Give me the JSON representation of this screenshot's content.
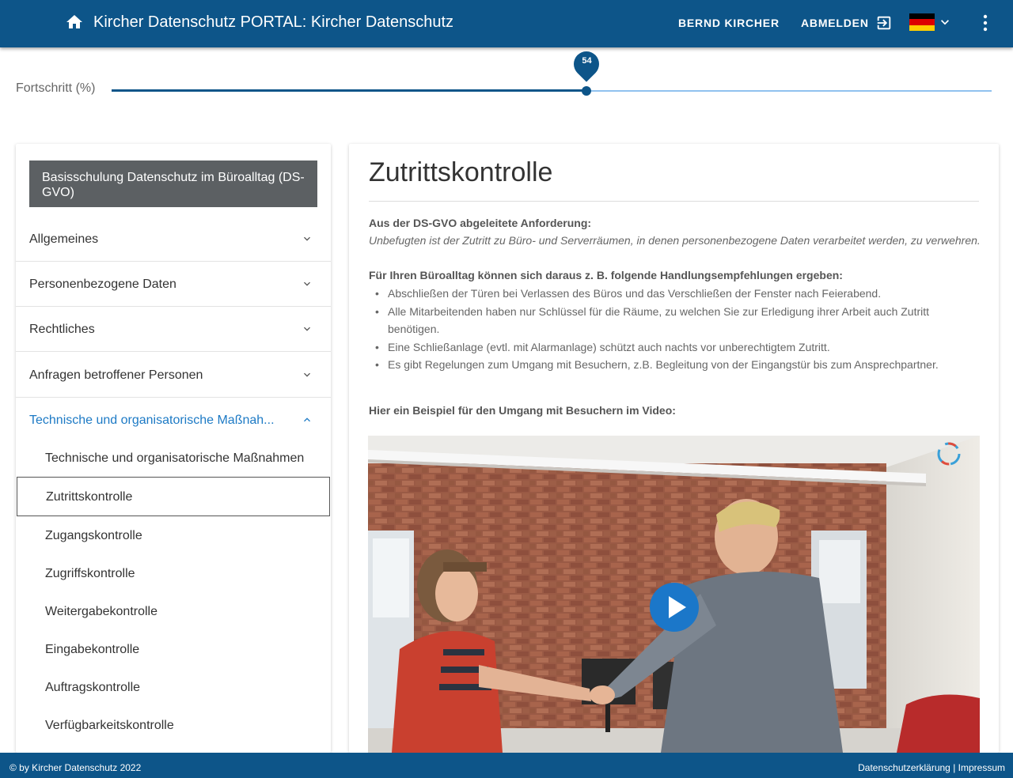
{
  "header": {
    "title": "Kircher Datenschutz PORTAL: Kircher Datenschutz",
    "user_label": "BERND KIRCHER",
    "logout_label": "ABMELDEN",
    "home_icon": "home-icon",
    "logout_icon": "logout-icon",
    "language_icon": "german-flag-icon",
    "menu_icon": "more-vert-icon",
    "colors": {
      "bar": "#0d5589",
      "accent": "#1d7ac5"
    }
  },
  "progress": {
    "label": "Fortschritt (%)",
    "value": 54,
    "value_display": "54"
  },
  "sidebar": {
    "course_title": "Basisschulung Datenschutz im Büroalltag (DS-GVO)",
    "sections": [
      {
        "label": "Allgemeines",
        "expanded": false
      },
      {
        "label": "Personenbezogene Daten",
        "expanded": false
      },
      {
        "label": "Rechtliches",
        "expanded": false
      },
      {
        "label": "Anfragen betroffener Personen",
        "expanded": false
      },
      {
        "label": "Technische und organisatorische Maßnah...",
        "expanded": true
      }
    ],
    "sub_items": [
      {
        "label": "Technische und organisatorische Maßnahmen"
      },
      {
        "label": "Zutrittskontrolle",
        "selected": true
      },
      {
        "label": "Zugangskontrolle"
      },
      {
        "label": "Zugriffskontrolle"
      },
      {
        "label": "Weitergabekontrolle"
      },
      {
        "label": "Eingabekontrolle"
      },
      {
        "label": "Auftragskontrolle"
      },
      {
        "label": "Verfügbarkeitskontrolle"
      }
    ]
  },
  "content": {
    "title": "Zutrittskontrolle",
    "requirement_heading": "Aus der DS-GVO abgeleitete Anforderung:",
    "requirement_text": "Unbefugten ist der Zutritt zu Büro- und Serverräumen, in denen personenbezogene Daten verarbeitet werden, zu verwehren.",
    "recommendations_heading": "Für Ihren Büroalltag können sich daraus z. B. folgende Handlungsempfehlungen ergeben:",
    "recommendations": [
      "Abschließen der Türen bei Verlassen des Büros und das Verschließen der Fenster nach Feierabend.",
      "Alle Mitarbeitenden haben nur Schlüssel für die Räume, zu welchen Sie zur Erledigung ihrer Arbeit auch Zutritt benötigen.",
      "Eine Schließanlage (evtl. mit Alarmanlage) schützt auch nachts vor unberechtigtem Zutritt.",
      "Es gibt Regelungen zum Umgang mit Besuchern, z.B. Begleitung von der Eingangstür bis zum Ansprechpartner."
    ],
    "video_heading": "Hier ein Beispiel für den Umgang mit Besuchern im Video:",
    "video_play_icon": "play-icon"
  },
  "footer": {
    "copyright": "© by Kircher Datenschutz 2022",
    "privacy_link": "Datenschutzerklärung",
    "separator": " | ",
    "imprint_link": "Impressum"
  }
}
